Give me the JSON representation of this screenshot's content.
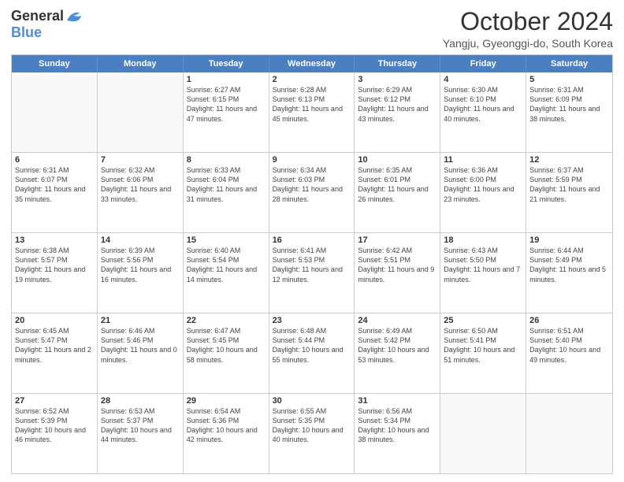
{
  "logo": {
    "general": "General",
    "blue": "Blue"
  },
  "header": {
    "month": "October 2024",
    "location": "Yangju, Gyeonggi-do, South Korea"
  },
  "days": [
    "Sunday",
    "Monday",
    "Tuesday",
    "Wednesday",
    "Thursday",
    "Friday",
    "Saturday"
  ],
  "rows": [
    [
      {
        "day": "",
        "info": ""
      },
      {
        "day": "",
        "info": ""
      },
      {
        "day": "1",
        "info": "Sunrise: 6:27 AM\nSunset: 6:15 PM\nDaylight: 11 hours and 47 minutes."
      },
      {
        "day": "2",
        "info": "Sunrise: 6:28 AM\nSunset: 6:13 PM\nDaylight: 11 hours and 45 minutes."
      },
      {
        "day": "3",
        "info": "Sunrise: 6:29 AM\nSunset: 6:12 PM\nDaylight: 11 hours and 43 minutes."
      },
      {
        "day": "4",
        "info": "Sunrise: 6:30 AM\nSunset: 6:10 PM\nDaylight: 11 hours and 40 minutes."
      },
      {
        "day": "5",
        "info": "Sunrise: 6:31 AM\nSunset: 6:09 PM\nDaylight: 11 hours and 38 minutes."
      }
    ],
    [
      {
        "day": "6",
        "info": "Sunrise: 6:31 AM\nSunset: 6:07 PM\nDaylight: 11 hours and 35 minutes."
      },
      {
        "day": "7",
        "info": "Sunrise: 6:32 AM\nSunset: 6:06 PM\nDaylight: 11 hours and 33 minutes."
      },
      {
        "day": "8",
        "info": "Sunrise: 6:33 AM\nSunset: 6:04 PM\nDaylight: 11 hours and 31 minutes."
      },
      {
        "day": "9",
        "info": "Sunrise: 6:34 AM\nSunset: 6:03 PM\nDaylight: 11 hours and 28 minutes."
      },
      {
        "day": "10",
        "info": "Sunrise: 6:35 AM\nSunset: 6:01 PM\nDaylight: 11 hours and 26 minutes."
      },
      {
        "day": "11",
        "info": "Sunrise: 6:36 AM\nSunset: 6:00 PM\nDaylight: 11 hours and 23 minutes."
      },
      {
        "day": "12",
        "info": "Sunrise: 6:37 AM\nSunset: 5:59 PM\nDaylight: 11 hours and 21 minutes."
      }
    ],
    [
      {
        "day": "13",
        "info": "Sunrise: 6:38 AM\nSunset: 5:57 PM\nDaylight: 11 hours and 19 minutes."
      },
      {
        "day": "14",
        "info": "Sunrise: 6:39 AM\nSunset: 5:56 PM\nDaylight: 11 hours and 16 minutes."
      },
      {
        "day": "15",
        "info": "Sunrise: 6:40 AM\nSunset: 5:54 PM\nDaylight: 11 hours and 14 minutes."
      },
      {
        "day": "16",
        "info": "Sunrise: 6:41 AM\nSunset: 5:53 PM\nDaylight: 11 hours and 12 minutes."
      },
      {
        "day": "17",
        "info": "Sunrise: 6:42 AM\nSunset: 5:51 PM\nDaylight: 11 hours and 9 minutes."
      },
      {
        "day": "18",
        "info": "Sunrise: 6:43 AM\nSunset: 5:50 PM\nDaylight: 11 hours and 7 minutes."
      },
      {
        "day": "19",
        "info": "Sunrise: 6:44 AM\nSunset: 5:49 PM\nDaylight: 11 hours and 5 minutes."
      }
    ],
    [
      {
        "day": "20",
        "info": "Sunrise: 6:45 AM\nSunset: 5:47 PM\nDaylight: 11 hours and 2 minutes."
      },
      {
        "day": "21",
        "info": "Sunrise: 6:46 AM\nSunset: 5:46 PM\nDaylight: 11 hours and 0 minutes."
      },
      {
        "day": "22",
        "info": "Sunrise: 6:47 AM\nSunset: 5:45 PM\nDaylight: 10 hours and 58 minutes."
      },
      {
        "day": "23",
        "info": "Sunrise: 6:48 AM\nSunset: 5:44 PM\nDaylight: 10 hours and 55 minutes."
      },
      {
        "day": "24",
        "info": "Sunrise: 6:49 AM\nSunset: 5:42 PM\nDaylight: 10 hours and 53 minutes."
      },
      {
        "day": "25",
        "info": "Sunrise: 6:50 AM\nSunset: 5:41 PM\nDaylight: 10 hours and 51 minutes."
      },
      {
        "day": "26",
        "info": "Sunrise: 6:51 AM\nSunset: 5:40 PM\nDaylight: 10 hours and 49 minutes."
      }
    ],
    [
      {
        "day": "27",
        "info": "Sunrise: 6:52 AM\nSunset: 5:39 PM\nDaylight: 10 hours and 46 minutes."
      },
      {
        "day": "28",
        "info": "Sunrise: 6:53 AM\nSunset: 5:37 PM\nDaylight: 10 hours and 44 minutes."
      },
      {
        "day": "29",
        "info": "Sunrise: 6:54 AM\nSunset: 5:36 PM\nDaylight: 10 hours and 42 minutes."
      },
      {
        "day": "30",
        "info": "Sunrise: 6:55 AM\nSunset: 5:35 PM\nDaylight: 10 hours and 40 minutes."
      },
      {
        "day": "31",
        "info": "Sunrise: 6:56 AM\nSunset: 5:34 PM\nDaylight: 10 hours and 38 minutes."
      },
      {
        "day": "",
        "info": ""
      },
      {
        "day": "",
        "info": ""
      }
    ]
  ]
}
